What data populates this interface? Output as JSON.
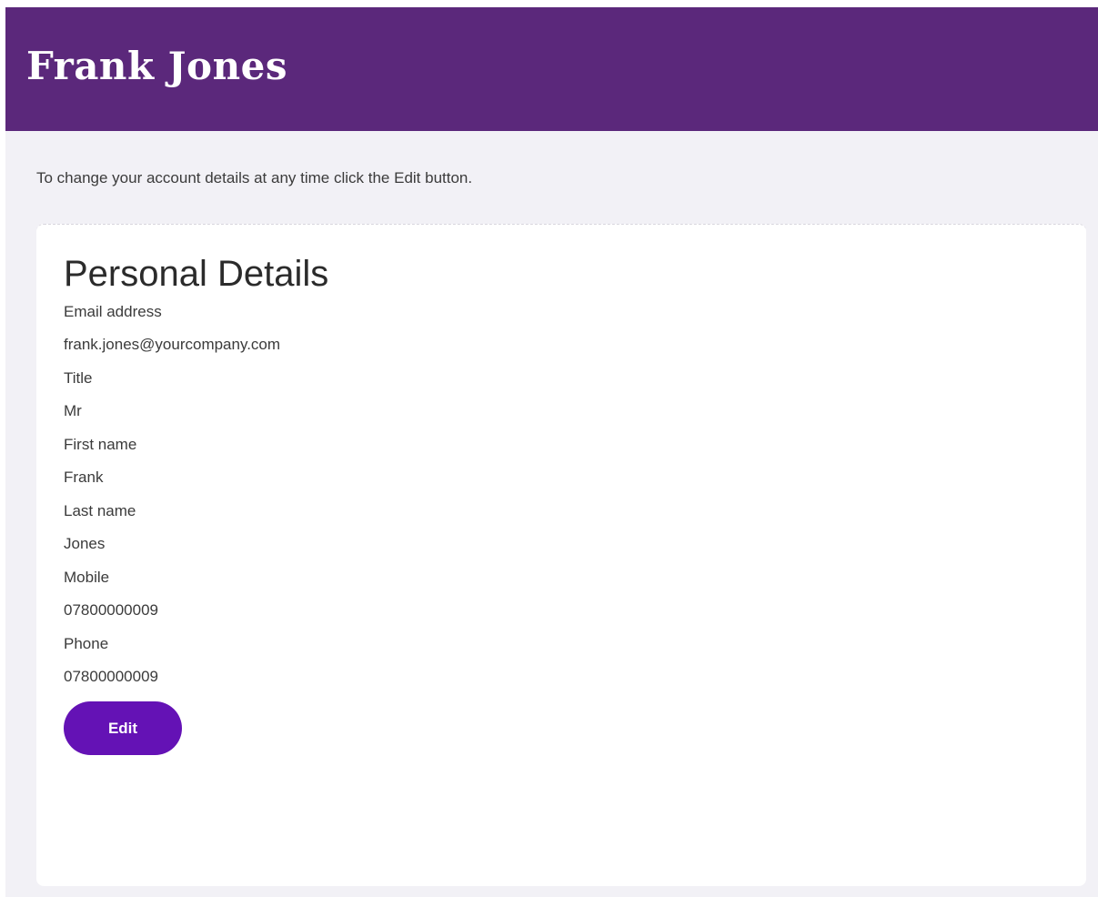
{
  "header": {
    "title": "Frank Jones"
  },
  "intro_text": "To change your account details at any time click the Edit button.",
  "card": {
    "heading": "Personal Details",
    "fields": [
      {
        "label": "Email address",
        "value": "frank.jones@yourcompany.com"
      },
      {
        "label": "Title",
        "value": "Mr"
      },
      {
        "label": "First name",
        "value": "Frank"
      },
      {
        "label": "Last name",
        "value": "Jones"
      },
      {
        "label": "Mobile",
        "value": "07800000009"
      },
      {
        "label": "Phone",
        "value": "07800000009"
      }
    ],
    "edit_label": "Edit"
  },
  "colors": {
    "header_bg": "#5b287b",
    "page_bg": "#f2f1f6",
    "button_bg": "#6412b5"
  }
}
